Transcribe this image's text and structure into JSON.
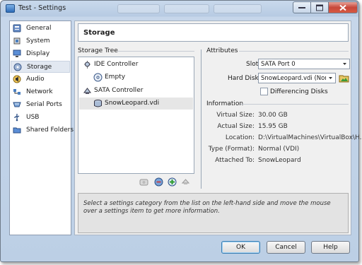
{
  "window": {
    "title": "Test - Settings"
  },
  "sidebar": {
    "items": [
      {
        "label": "General",
        "icon": "general-icon"
      },
      {
        "label": "System",
        "icon": "system-icon"
      },
      {
        "label": "Display",
        "icon": "display-icon"
      },
      {
        "label": "Storage",
        "icon": "storage-icon",
        "active": true
      },
      {
        "label": "Audio",
        "icon": "audio-icon"
      },
      {
        "label": "Network",
        "icon": "network-icon"
      },
      {
        "label": "Serial Ports",
        "icon": "serial-ports-icon"
      },
      {
        "label": "USB",
        "icon": "usb-icon"
      },
      {
        "label": "Shared Folders",
        "icon": "shared-folders-icon"
      }
    ]
  },
  "header": {
    "title": "Storage"
  },
  "tree": {
    "label": "Storage Tree",
    "items": [
      {
        "label": "IDE Controller",
        "icon": "ide-controller-icon",
        "level": 0
      },
      {
        "label": "Empty",
        "icon": "cd-disc-icon",
        "level": 1
      },
      {
        "label": "SATA Controller",
        "icon": "sata-controller-icon",
        "level": 0
      },
      {
        "label": "SnowLeopard.vdi",
        "icon": "hard-disk-icon",
        "level": 1,
        "selected": true
      }
    ],
    "toolbar": [
      "add-controller-icon",
      "remove-controller-icon",
      "add-attachment-icon",
      "remove-attachment-icon"
    ]
  },
  "attributes": {
    "heading": "Attributes",
    "slot_label": "Slot:",
    "slot_value": "SATA Port 0",
    "disk_label": "Hard Disk:",
    "disk_value": "SnowLeopard.vdi (Norma",
    "differencing_label": "Differencing Disks",
    "differencing_checked": false
  },
  "information": {
    "heading": "Information",
    "rows": [
      {
        "label": "Virtual Size:",
        "value": "30.00 GB"
      },
      {
        "label": "Actual Size:",
        "value": "15.95 GB"
      },
      {
        "label": "Location:",
        "value": "D:\\VirtualMachines\\VirtualBox\\H..."
      },
      {
        "label": "Type (Format):",
        "value": "Normal (VDI)"
      },
      {
        "label": "Attached To:",
        "value": "SnowLeopard"
      }
    ]
  },
  "description": "Select a settings category from the list on the left-hand side and move the mouse over a settings item to get more information.",
  "buttons": {
    "ok": "OK",
    "cancel": "Cancel",
    "help": "Help"
  },
  "colors": {
    "selection": "#e2e8f1",
    "frame": "#bccfe5",
    "close": "#c7473a"
  }
}
